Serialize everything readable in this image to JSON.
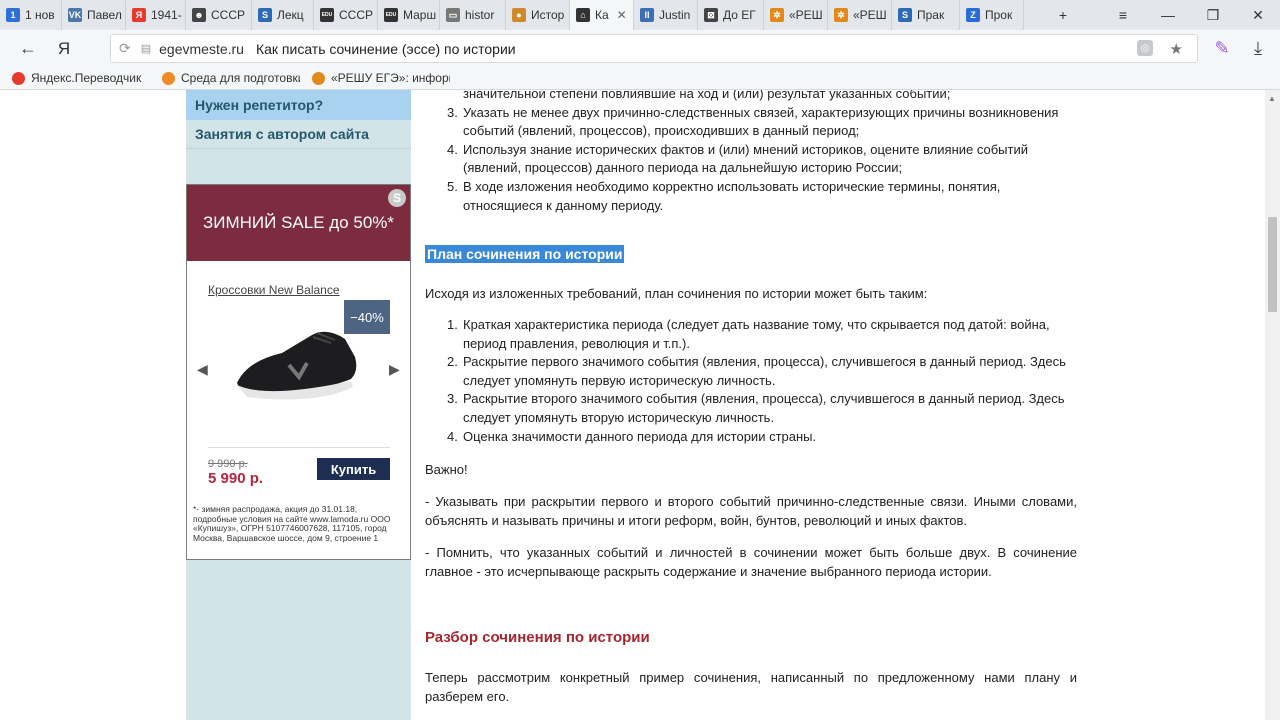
{
  "tabs": [
    {
      "label": "1 нов",
      "icon": "mail-1",
      "color": "#2f6fd6",
      "glyph": "1"
    },
    {
      "label": "Павел",
      "icon": "vk-icon",
      "color": "#4a76a8",
      "glyph": "VK"
    },
    {
      "label": "1941-",
      "icon": "yandex-icon",
      "color": "#e63a2e",
      "glyph": "Я"
    },
    {
      "label": "СССР",
      "icon": "mask-icon",
      "color": "#444444",
      "glyph": "☻"
    },
    {
      "label": "Лекц",
      "icon": "s-icon",
      "color": "#2b6bb5",
      "glyph": "S"
    },
    {
      "label": "СССР",
      "icon": "edu-icon",
      "color": "#333333",
      "glyph": "EDU"
    },
    {
      "label": "Марш",
      "icon": "edu-icon",
      "color": "#333333",
      "glyph": "EDU"
    },
    {
      "label": "histor",
      "icon": "doc-icon",
      "color": "#777777",
      "glyph": "▭"
    },
    {
      "label": "Истор",
      "icon": "cookie-icon",
      "color": "#d08a2b",
      "glyph": "●"
    },
    {
      "label": "Ка",
      "icon": "book-icon",
      "color": "#333333",
      "glyph": "⌂",
      "active": true
    },
    {
      "label": "Justin",
      "icon": "pause-icon",
      "color": "#3b6fb6",
      "glyph": "II"
    },
    {
      "label": "До ЕГ",
      "icon": "film-icon",
      "color": "#444444",
      "glyph": "⊠"
    },
    {
      "label": "«РЕШ",
      "icon": "reshu-icon",
      "color": "#e08a1e",
      "glyph": "✲"
    },
    {
      "label": "«РЕШ",
      "icon": "reshu-icon",
      "color": "#e08a1e",
      "glyph": "✲"
    },
    {
      "label": "Прак",
      "icon": "s-icon",
      "color": "#2b6bb5",
      "glyph": "S"
    },
    {
      "label": "Прок",
      "icon": "z-icon",
      "color": "#2b6bd6",
      "glyph": "Z"
    }
  ],
  "address": {
    "domain": "egevmeste.ru",
    "title": "Как писать сочинение (эссе) по истории"
  },
  "bookmarks": [
    {
      "label": "Яндекс.Переводчик",
      "color": "#e63a2e"
    },
    {
      "label": "Среда для подготовки",
      "color": "#f08a24"
    },
    {
      "label": "«РЕШУ ЕГЭ»: информатика",
      "color": "#e08a1e"
    }
  ],
  "sidebar": {
    "tutor": "Нужен репетитор?",
    "classes": "Занятия с автором сайта"
  },
  "ad": {
    "headline": "ЗИМНИЙ SALE до 50%*",
    "product": "Кроссовки New Balance",
    "discount": "−40%",
    "old_price": "9 990 р.",
    "new_price": "5 990 р.",
    "buy": "Купить",
    "fine_print": "*- зимняя распродажа, акция до 31.01.18, подробные условия на сайте www.lamoda.ru ООО «Купишуз», ОГРН 5107746007628, 117105, город Москва, Варшавское шоссе, дом 9, строение 1"
  },
  "requirements": [
    {
      "num": "",
      "text": "значительной степени повлиявшие на ход и (или) результат указанных событий;"
    },
    {
      "num": "3.",
      "text": "Указать не менее двух причинно-следственных связей, характеризующих причины возникновения событий (явлений, процессов), происходивших в данный период;"
    },
    {
      "num": "4.",
      "text": "Используя знание исторических фактов и (или) мнений историков, оцените влияние событий (явлений, процессов) данного периода на дальнейшую историю России;"
    },
    {
      "num": "5.",
      "text": "В ходе изложения необходимо корректно использовать исторические термины, понятия, относящиеся к данному периоду."
    }
  ],
  "plan": {
    "heading": "План сочинения по истории",
    "intro": "Исходя из изложенных требований, план сочинения по истории может быть таким:",
    "items": [
      {
        "num": "1.",
        "text": "Краткая характеристика периода (следует дать название тому, что скрывается под датой: война, период правления, революция и т.п.)."
      },
      {
        "num": "2.",
        "text": "Раскрытие первого значимого события (явления, процесса), случившегося в данный период. Здесь следует упомянуть первую историческую личность."
      },
      {
        "num": "3.",
        "text": "Раскрытие второго значимого события (явления, процесса), случившегося в данный период. Здесь следует упомянуть вторую историческую личность."
      },
      {
        "num": "4.",
        "text": "Оценка значимости данного периода для истории страны."
      }
    ],
    "important": "Важно!",
    "note1": "- Указывать при раскрытии первого и второго событий причинно-следственные связи. Иными словами, объяснять и называть причины и итоги реформ, войн, бунтов, революций и иных фактов.",
    "note2": "- Помнить, что указанных событий и личностей в сочинении может быть больше двух. В сочинение главное - это исчерпывающе раскрыть содержание и значение выбранного периода истории."
  },
  "analysis": {
    "heading": "Разбор сочинения по истории",
    "intro": "Теперь рассмотрим конкретный пример сочинения, написанный по предложенному нами плану и разберем его."
  }
}
